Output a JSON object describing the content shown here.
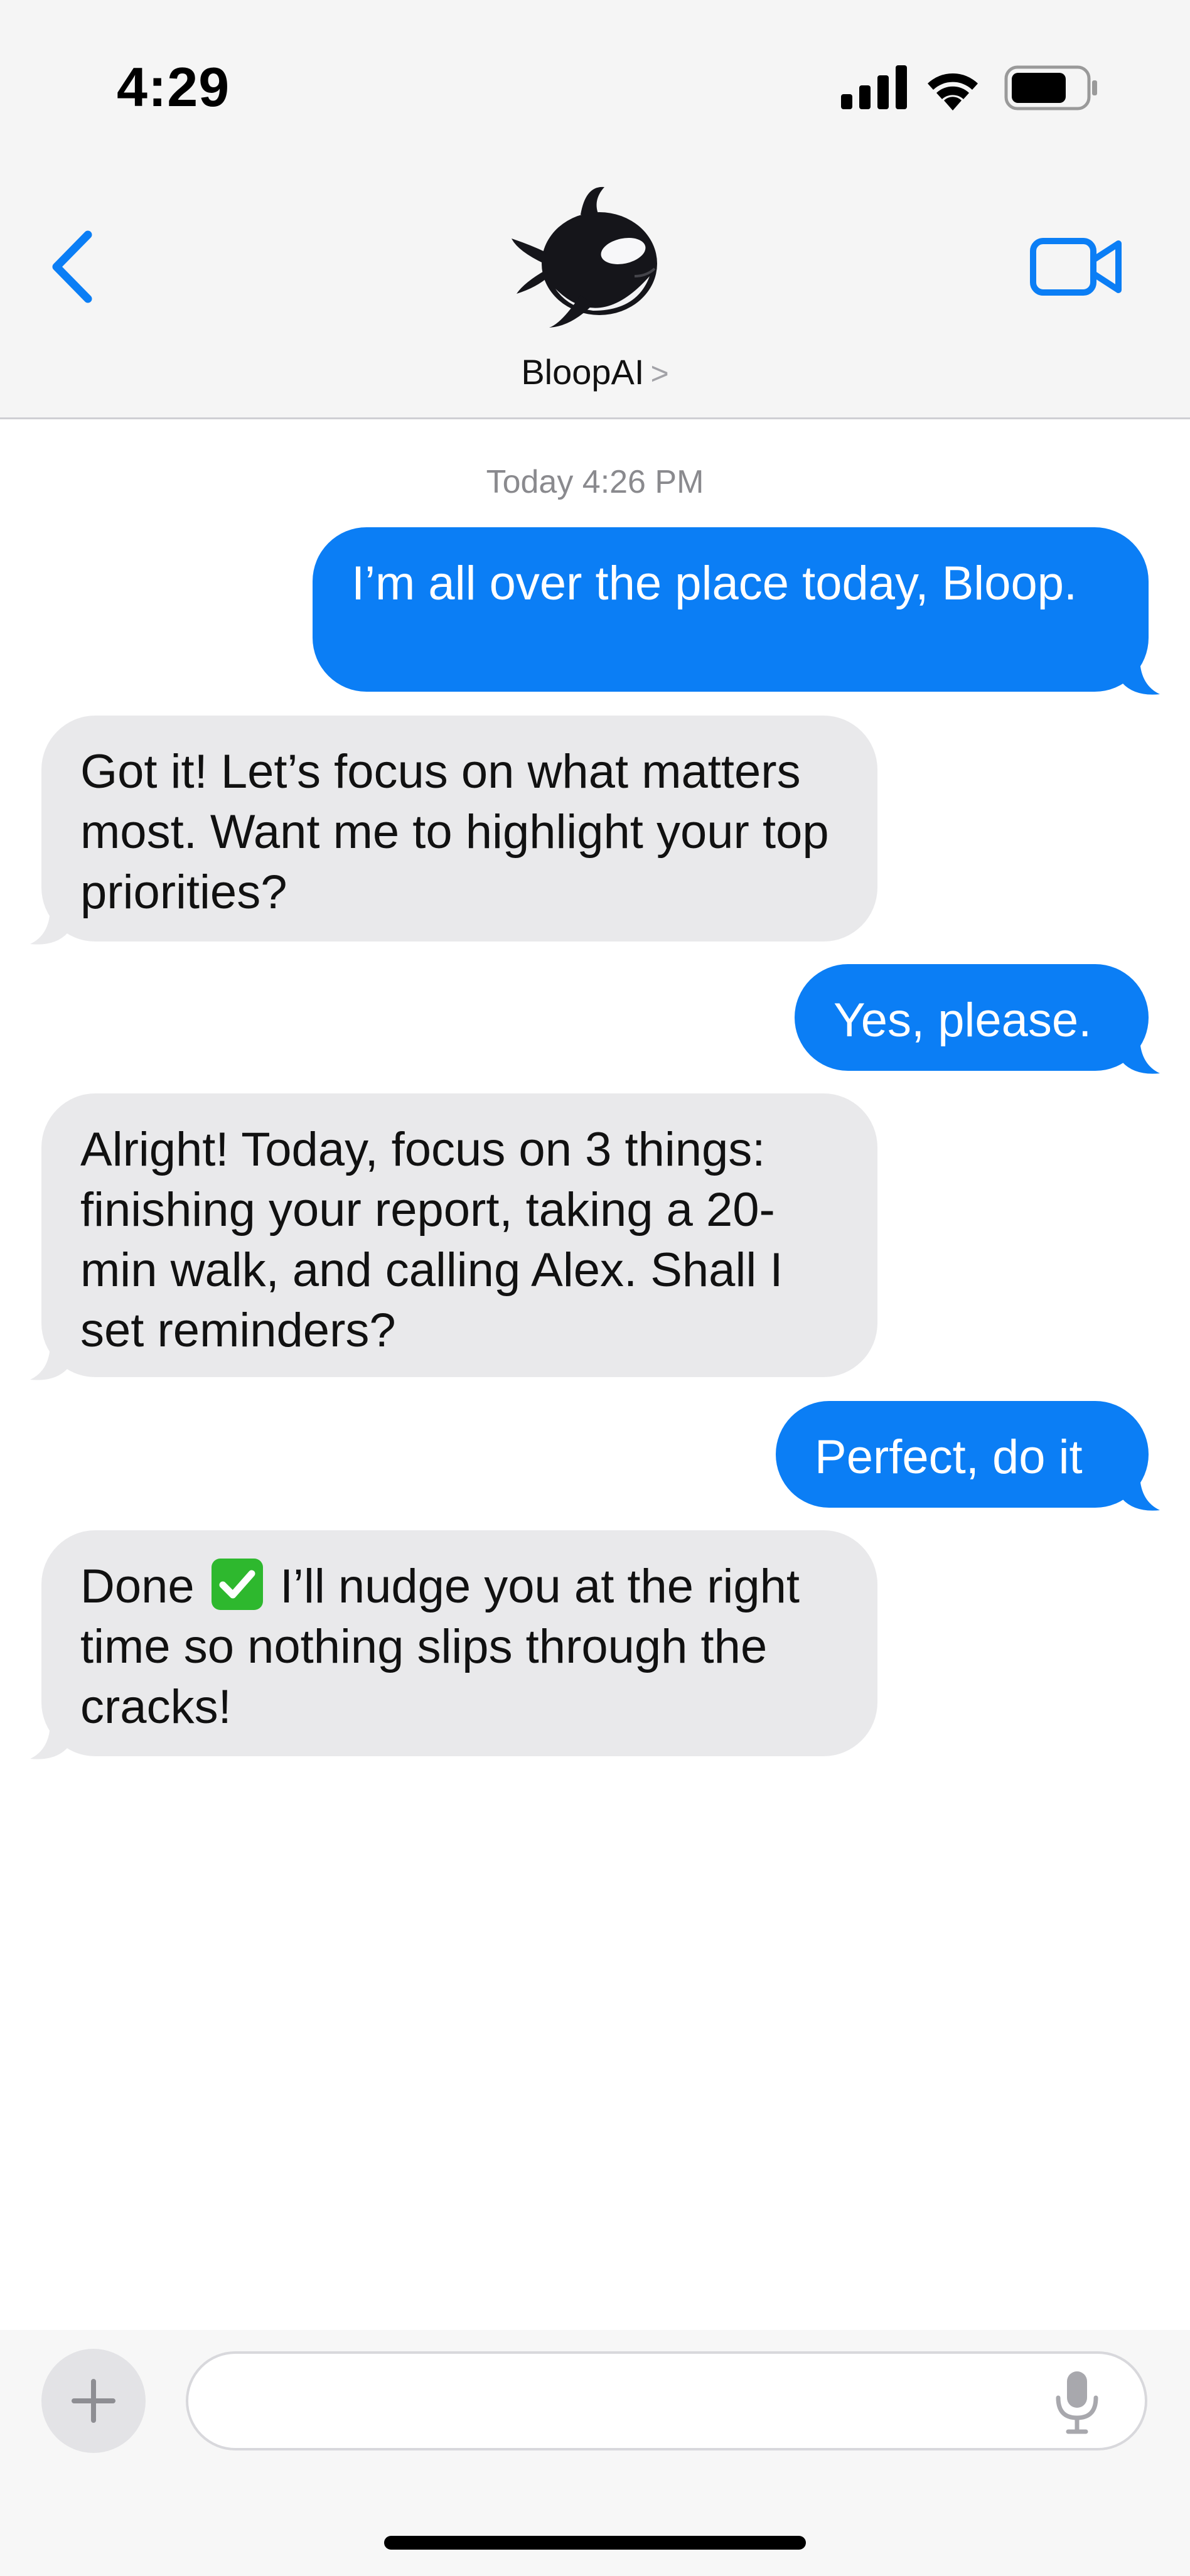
{
  "status_bar": {
    "time": "4:29",
    "signal_icon": "cellular-signal-icon",
    "wifi_icon": "wifi-icon",
    "battery_icon": "battery-icon",
    "battery_level": 0.75
  },
  "header": {
    "back_icon": "chevron-left-icon",
    "avatar": "orca-avatar",
    "contact_name": "BloopAI",
    "contact_chevron": ">",
    "video_icon": "video-camera-icon"
  },
  "conversation": {
    "timestamp": "Today 4:26 PM",
    "messages": [
      {
        "direction": "outgoing",
        "text": "I’m all over the place today, Bloop."
      },
      {
        "direction": "incoming",
        "text": "Got it! Let’s focus on what matters most. Want me to highlight your top priorities?"
      },
      {
        "direction": "outgoing",
        "text": "Yes, please."
      },
      {
        "direction": "incoming",
        "text": "Alright! Today, focus on 3 things: finishing your report, taking a 20-min walk, and calling Alex. Shall I set reminders?"
      },
      {
        "direction": "outgoing",
        "text": "Perfect, do it"
      },
      {
        "direction": "incoming",
        "text_before": "Done",
        "emoji": "check-mark-button-icon",
        "text_after": "I’ll nudge you at the right time so nothing slips through the cracks!"
      }
    ]
  },
  "composer": {
    "plus_icon": "plus-icon",
    "input_value": "",
    "placeholder": "",
    "mic_icon": "microphone-icon"
  },
  "colors": {
    "accent": "#0b7ef5",
    "incoming_bubble": "#e9e9eb",
    "header_bg": "#f5f5f5"
  }
}
